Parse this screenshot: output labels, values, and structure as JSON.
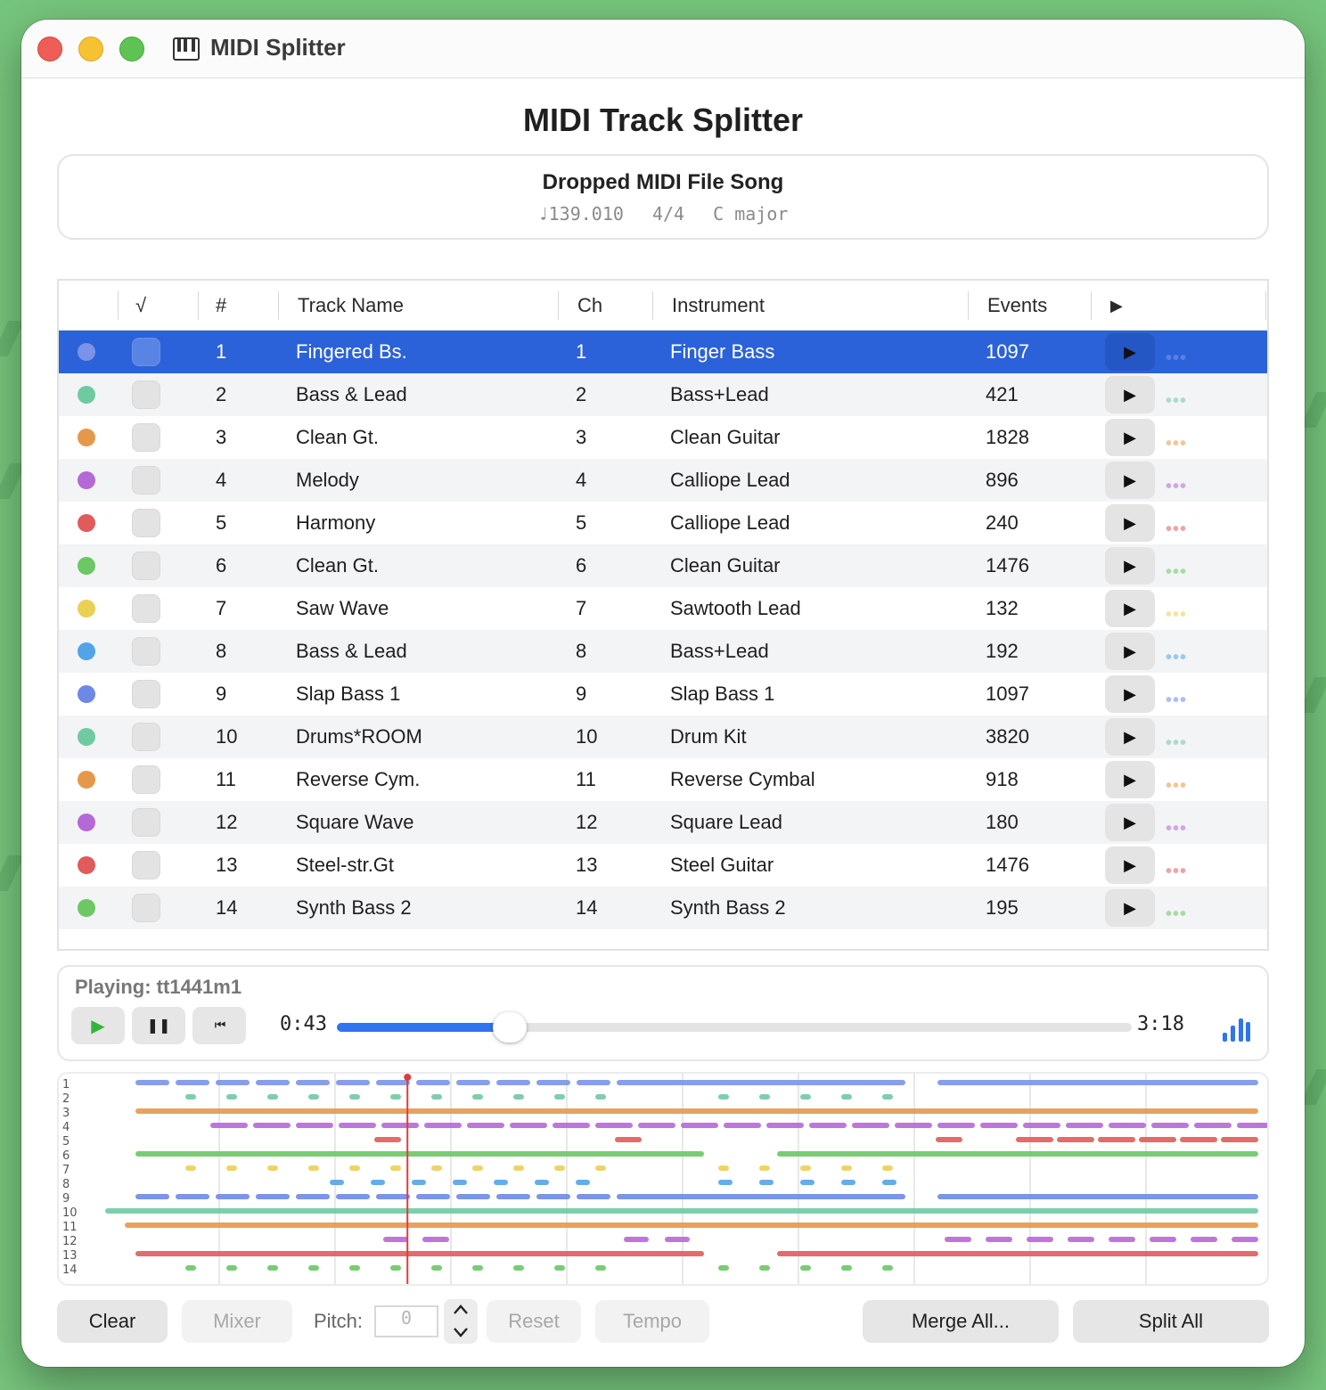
{
  "window": {
    "title": "MIDI Splitter",
    "icon": "piano-keys-icon"
  },
  "header": {
    "title": "MIDI Track Splitter"
  },
  "song": {
    "name": "Dropped MIDI File Song",
    "tempo": "♩139.010",
    "time_signature": "4/4",
    "key": "C major"
  },
  "table": {
    "headers": {
      "check": "√",
      "num": "#",
      "name": "Track Name",
      "ch": "Ch",
      "instrument": "Instrument",
      "events": "Events",
      "play": "▶"
    },
    "rows": [
      {
        "num": "1",
        "name": "Fingered Bs.",
        "ch": "1",
        "instrument": "Finger Bass",
        "events": "1097",
        "color": "#7a93e8",
        "selected": true
      },
      {
        "num": "2",
        "name": "Bass & Lead",
        "ch": "2",
        "instrument": "Bass+Lead",
        "events": "421",
        "color": "#6fcaa2"
      },
      {
        "num": "3",
        "name": "Clean Gt.",
        "ch": "3",
        "instrument": "Clean Guitar",
        "events": "1828",
        "color": "#e5984a"
      },
      {
        "num": "4",
        "name": "Melody",
        "ch": "4",
        "instrument": "Calliope Lead",
        "events": "896",
        "color": "#b469d6"
      },
      {
        "num": "5",
        "name": "Harmony",
        "ch": "5",
        "instrument": "Calliope Lead",
        "events": "240",
        "color": "#e05b5b"
      },
      {
        "num": "6",
        "name": "Clean Gt.",
        "ch": "6",
        "instrument": "Clean Guitar",
        "events": "1476",
        "color": "#6cc765"
      },
      {
        "num": "7",
        "name": "Saw Wave",
        "ch": "7",
        "instrument": "Sawtooth Lead",
        "events": "132",
        "color": "#ead055"
      },
      {
        "num": "8",
        "name": "Bass & Lead",
        "ch": "8",
        "instrument": "Bass+Lead",
        "events": "192",
        "color": "#52a4e8"
      },
      {
        "num": "9",
        "name": "Slap Bass 1",
        "ch": "9",
        "instrument": "Slap Bass 1",
        "events": "1097",
        "color": "#6d89e6"
      },
      {
        "num": "10",
        "name": "Drums*ROOM",
        "ch": "10",
        "instrument": "Drum Kit",
        "events": "3820",
        "color": "#6fcaa2"
      },
      {
        "num": "11",
        "name": "Reverse Cym.",
        "ch": "11",
        "instrument": "Reverse Cymbal",
        "events": "918",
        "color": "#e5984a"
      },
      {
        "num": "12",
        "name": "Square Wave",
        "ch": "12",
        "instrument": "Square Lead",
        "events": "180",
        "color": "#b469d6"
      },
      {
        "num": "13",
        "name": "Steel-str.Gt",
        "ch": "13",
        "instrument": "Steel Guitar",
        "events": "1476",
        "color": "#e05b5b"
      },
      {
        "num": "14",
        "name": "Synth Bass 2",
        "ch": "14",
        "instrument": "Synth Bass 2",
        "events": "195",
        "color": "#6cc765"
      }
    ],
    "play_symbol": "▶",
    "more_symbol": "•••"
  },
  "player": {
    "playing_label": "Playing: tt1441m1",
    "current_time": "0:43",
    "total_time": "3:18",
    "progress": 0.217,
    "play_symbol": "▶",
    "pause_symbol": "❚❚",
    "rewind_symbol": "⏮",
    "levels_icon": "audio-levels-icon"
  },
  "piano_roll": {
    "lane_labels": [
      "1",
      "2",
      "3",
      "4",
      "5",
      "6",
      "7",
      "8",
      "9",
      "10",
      "11",
      "12",
      "13",
      "14"
    ],
    "playhead": 0.217
  },
  "toolbar": {
    "clear": "Clear",
    "mixer": "Mixer",
    "pitch_label": "Pitch:",
    "pitch_value": "0",
    "reset": "Reset",
    "tempo": "Tempo",
    "merge_all": "Merge All...",
    "split_all": "Split All"
  }
}
